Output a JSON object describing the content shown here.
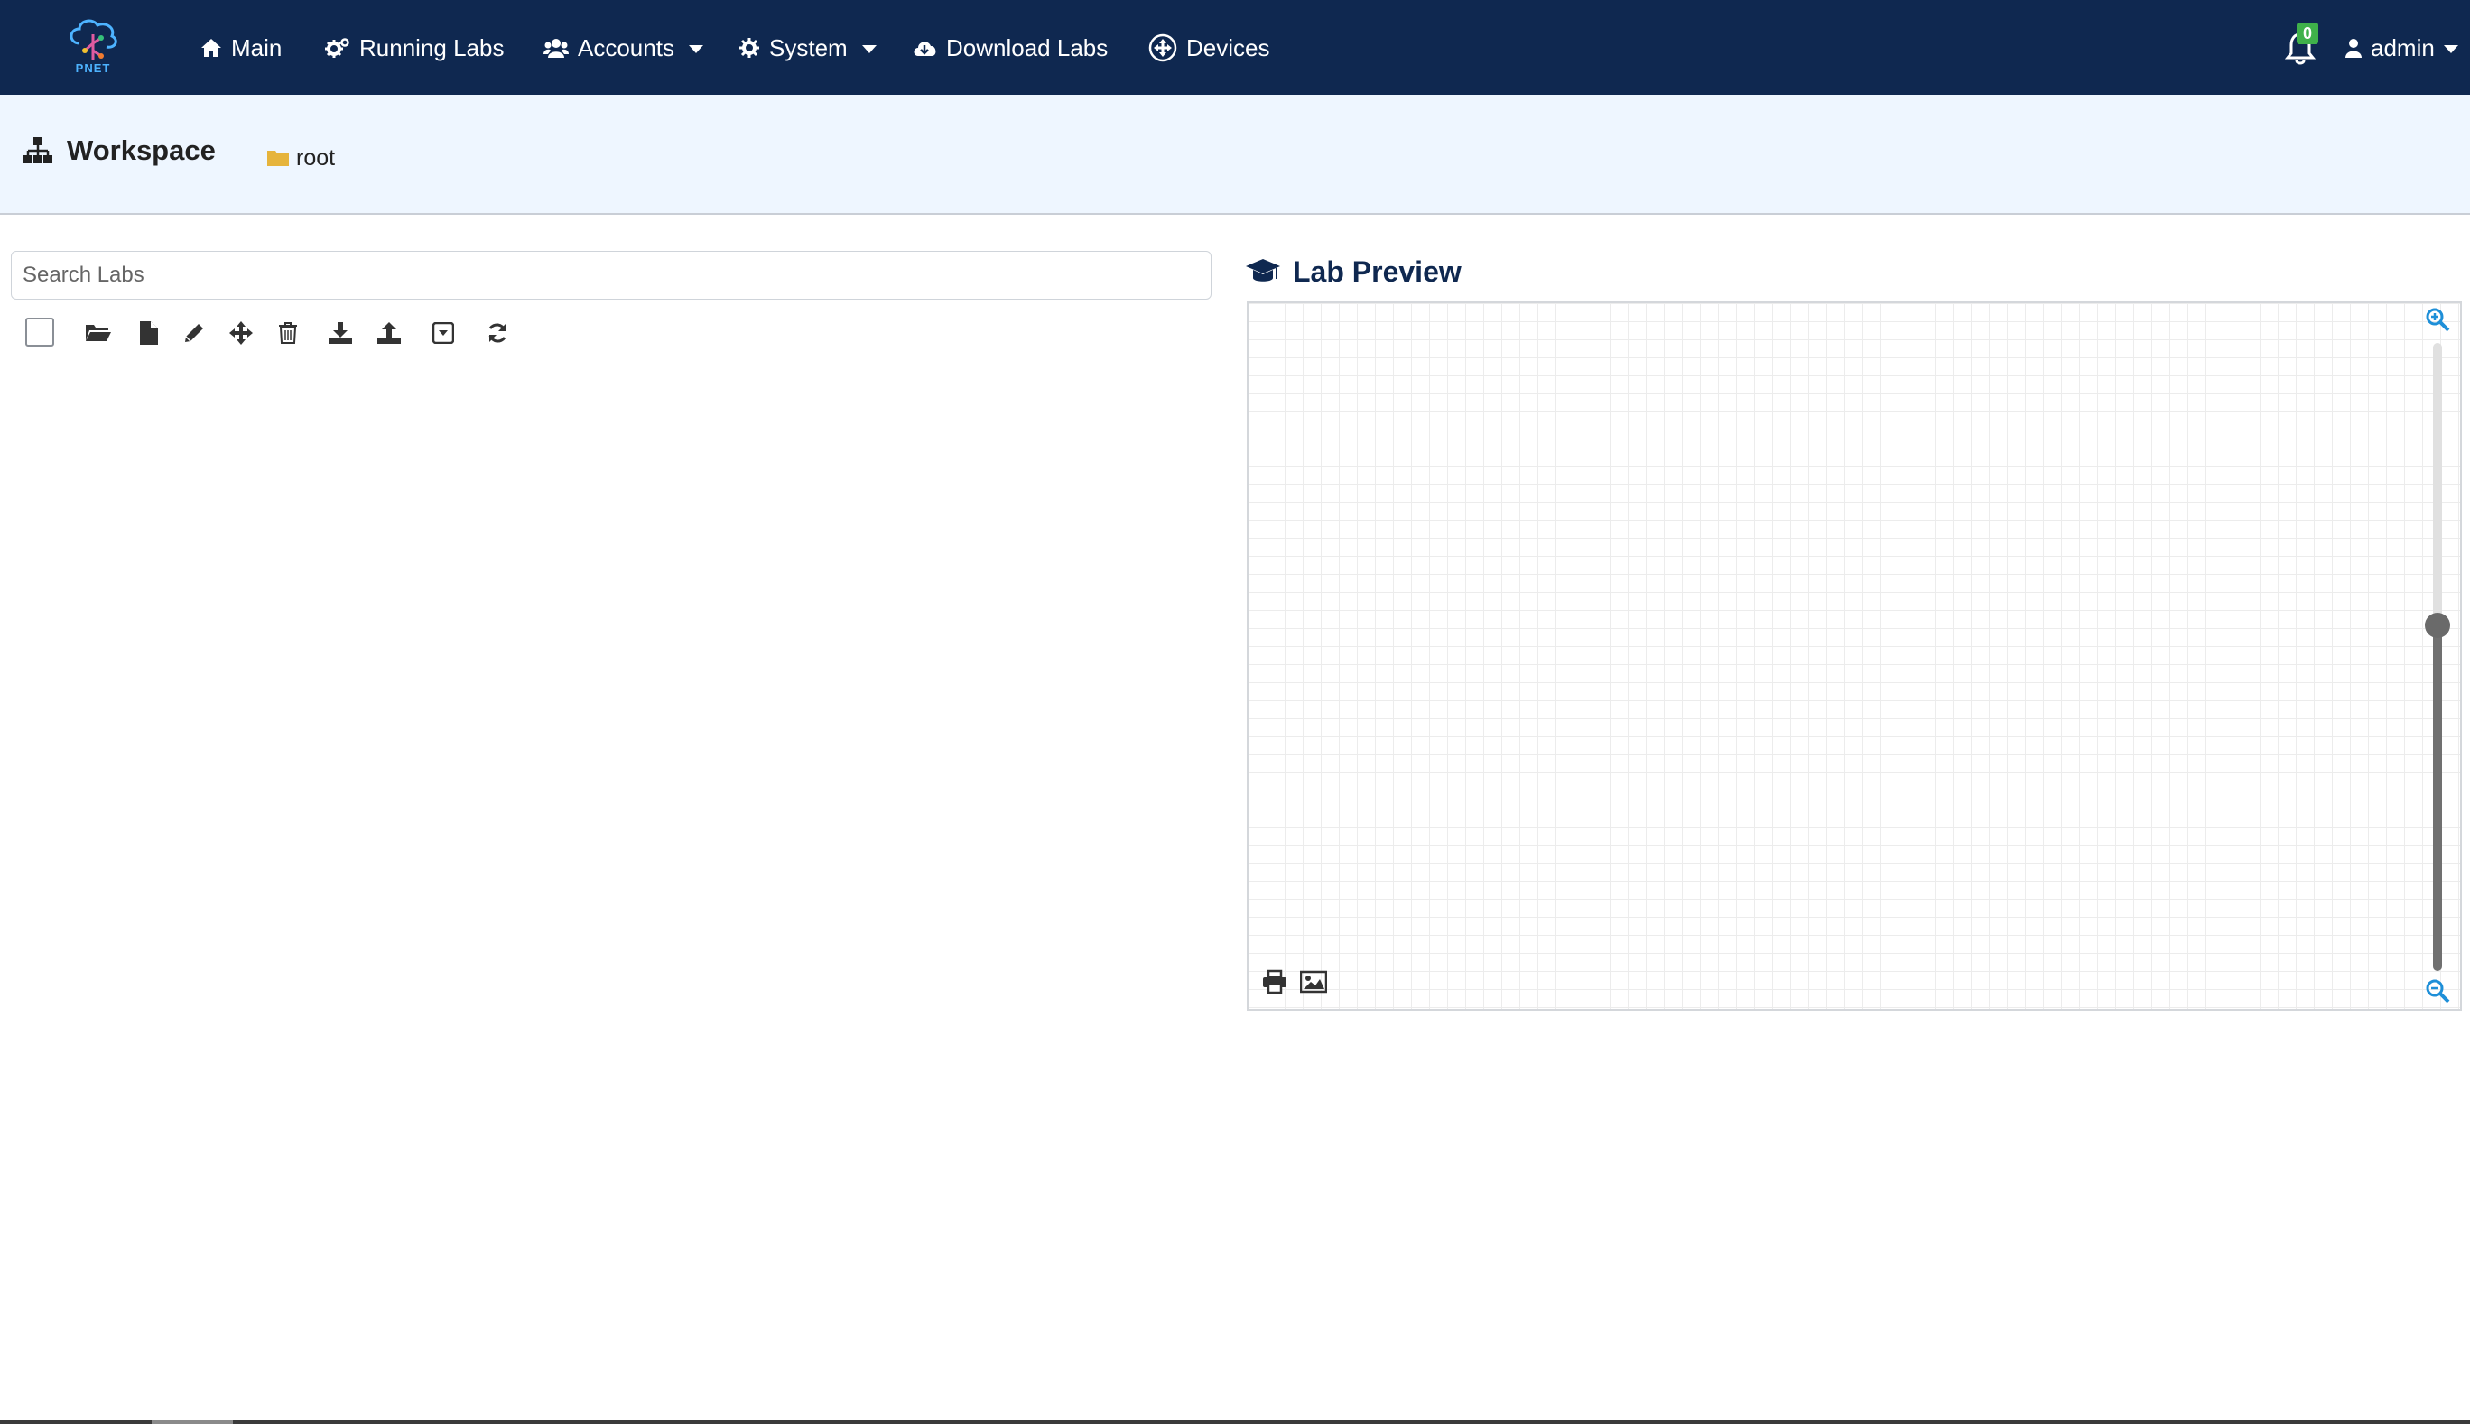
{
  "colors": {
    "navbar": "#0f2850",
    "workspace_header": "#eef6ff",
    "badge": "#3fb14a",
    "accent": "#1e8fd8",
    "folder": "#e6b43c"
  },
  "logo": {
    "text": "PNET"
  },
  "nav": {
    "main": "Main",
    "running_labs": "Running Labs",
    "accounts": "Accounts",
    "system": "System",
    "download_labs": "Download Labs",
    "devices": "Devices",
    "notifications_count": "0",
    "user": "admin"
  },
  "workspace": {
    "title": "Workspace",
    "breadcrumb": "root"
  },
  "search": {
    "placeholder": "Search Labs",
    "value": ""
  },
  "toolbar": {
    "icons": [
      "checkbox-select-all",
      "folder-open-icon",
      "file-icon",
      "pencil-icon",
      "move-icon",
      "trash-icon",
      "download-icon",
      "upload-icon",
      "archive-icon",
      "refresh-icon"
    ]
  },
  "preview": {
    "title": "Lab Preview",
    "zoom_level": 0.55
  }
}
